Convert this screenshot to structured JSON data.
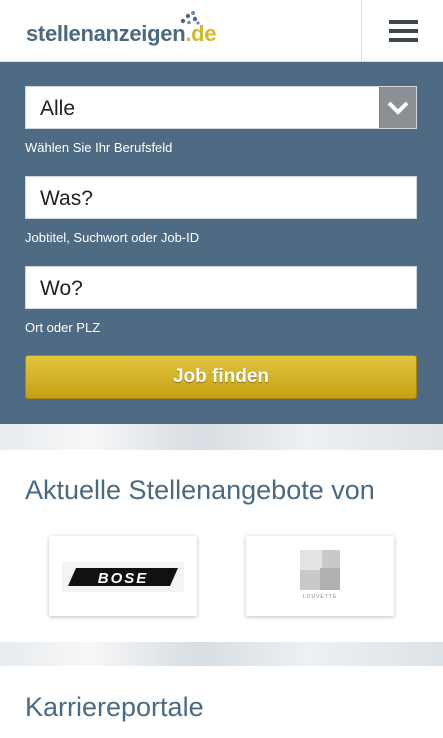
{
  "header": {
    "logo_main": "stellenanzeigen",
    "logo_dot": ".",
    "logo_tld": "de"
  },
  "search": {
    "category_value": "Alle",
    "category_hint": "Wählen Sie Ihr Berufsfeld",
    "what_value": "Was?",
    "what_hint": "Jobtitel, Suchwort oder Job-ID",
    "where_value": "Wo?",
    "where_hint": "Ort oder PLZ",
    "submit_label": "Job finden"
  },
  "companies": {
    "title": "Aktuelle Stellenangebote von",
    "items": [
      {
        "name": "BOSE",
        "logo": "bose-logo"
      },
      {
        "name": "LOUVETTE",
        "logo": "louvette-logo"
      }
    ]
  },
  "portals": {
    "title": "Karriereportale"
  },
  "colors": {
    "brand_blue": "#4b6a82",
    "brand_gold": "#d6b531",
    "panel": "#4f6b83",
    "button_gold": "#d4b32a"
  }
}
